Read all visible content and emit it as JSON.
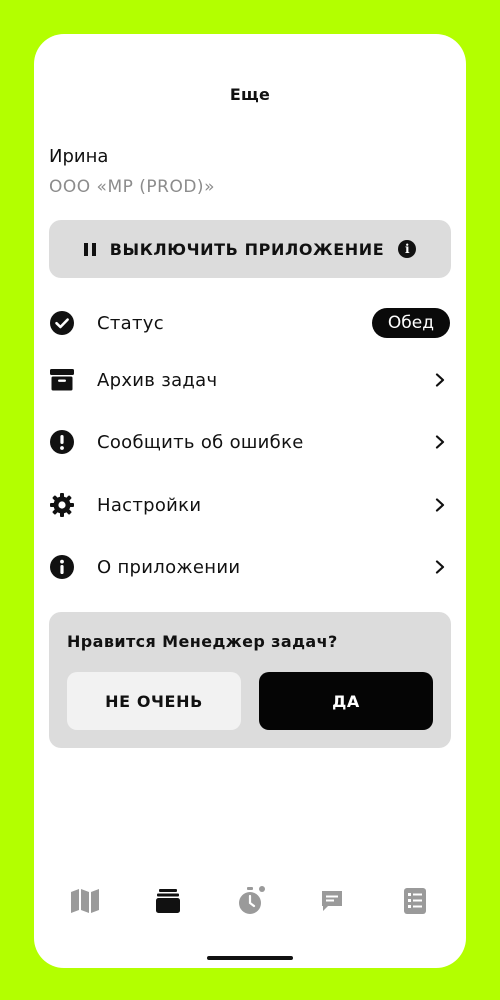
{
  "header": {
    "title": "Еще"
  },
  "profile": {
    "name": "Ирина",
    "company": "ООО «MP (PROD)»"
  },
  "disable_button": {
    "label": "ВЫКЛЮЧИТЬ ПРИЛОЖЕНИЕ",
    "left_icon": "pause-icon",
    "right_icon": "info-icon"
  },
  "menu": {
    "items": [
      {
        "label": "Статус",
        "icon": "check-circle-icon",
        "badge": "Обед"
      },
      {
        "label": "Архив задач",
        "icon": "archive-box-icon"
      },
      {
        "label": "Сообщить об ошибке",
        "icon": "exclamation-circle-icon"
      },
      {
        "label": "Настройки",
        "icon": "gear-icon"
      },
      {
        "label": "О приложении",
        "icon": "info-icon"
      }
    ]
  },
  "rating": {
    "question": "Нравится Менеджер задач?",
    "no_label": "НЕ ОЧЕНЬ",
    "yes_label": "ДА"
  },
  "tabbar": {
    "tabs": [
      {
        "icon": "map-icon",
        "active": false
      },
      {
        "icon": "stack-icon",
        "active": true
      },
      {
        "icon": "stopwatch-icon",
        "active": false,
        "dot": true
      },
      {
        "icon": "chat-icon",
        "active": false
      },
      {
        "icon": "list-icon",
        "active": false
      }
    ]
  },
  "colors": {
    "background": "#b3ff00",
    "surface": "#ffffff",
    "card": "#dcdcdc",
    "primary": "#050505",
    "muted": "#8c8c8c",
    "tab_inactive": "#9a9a9a"
  }
}
